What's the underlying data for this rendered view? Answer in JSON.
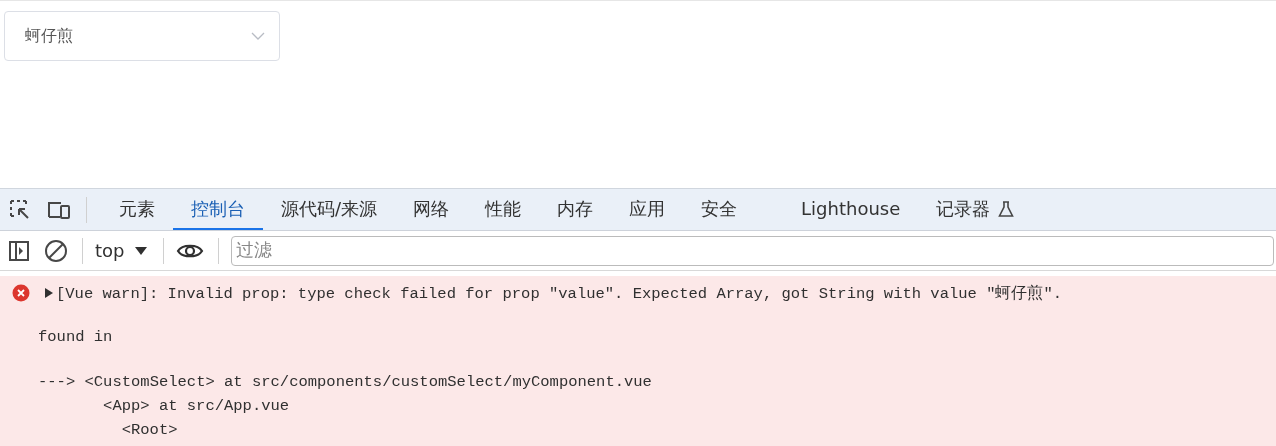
{
  "select": {
    "value": "蚵仔煎",
    "expanded": false
  },
  "devtools": {
    "tabs": [
      {
        "label": "元素",
        "selected": false
      },
      {
        "label": "控制台",
        "selected": true
      },
      {
        "label": "源代码/来源",
        "selected": false
      },
      {
        "label": "网络",
        "selected": false
      },
      {
        "label": "性能",
        "selected": false
      },
      {
        "label": "内存",
        "selected": false
      },
      {
        "label": "应用",
        "selected": false
      },
      {
        "label": "安全",
        "selected": false
      },
      {
        "label": "Lighthouse",
        "selected": false
      },
      {
        "label": "记录器",
        "selected": false,
        "experimental": true
      }
    ],
    "toolbar": {
      "context": "top",
      "filter": {
        "placeholder": "过滤"
      }
    },
    "messages": [
      {
        "kind": "error",
        "expanded": false,
        "text": "[Vue warn]: Invalid prop: type check failed for prop \"value\". Expected Array, got String with value \"蚵仔煎\".",
        "found_in": "found in",
        "trace_arrow": "--->",
        "trace": [
          {
            "text": "<CustomSelect> at src/components/customSelect/myComponent.vue",
            "children": [
              {
                "text": "<App> at src/App.vue",
                "children": [
                  {
                    "text": "<Root>"
                  }
                ]
              }
            ]
          }
        ]
      }
    ]
  }
}
